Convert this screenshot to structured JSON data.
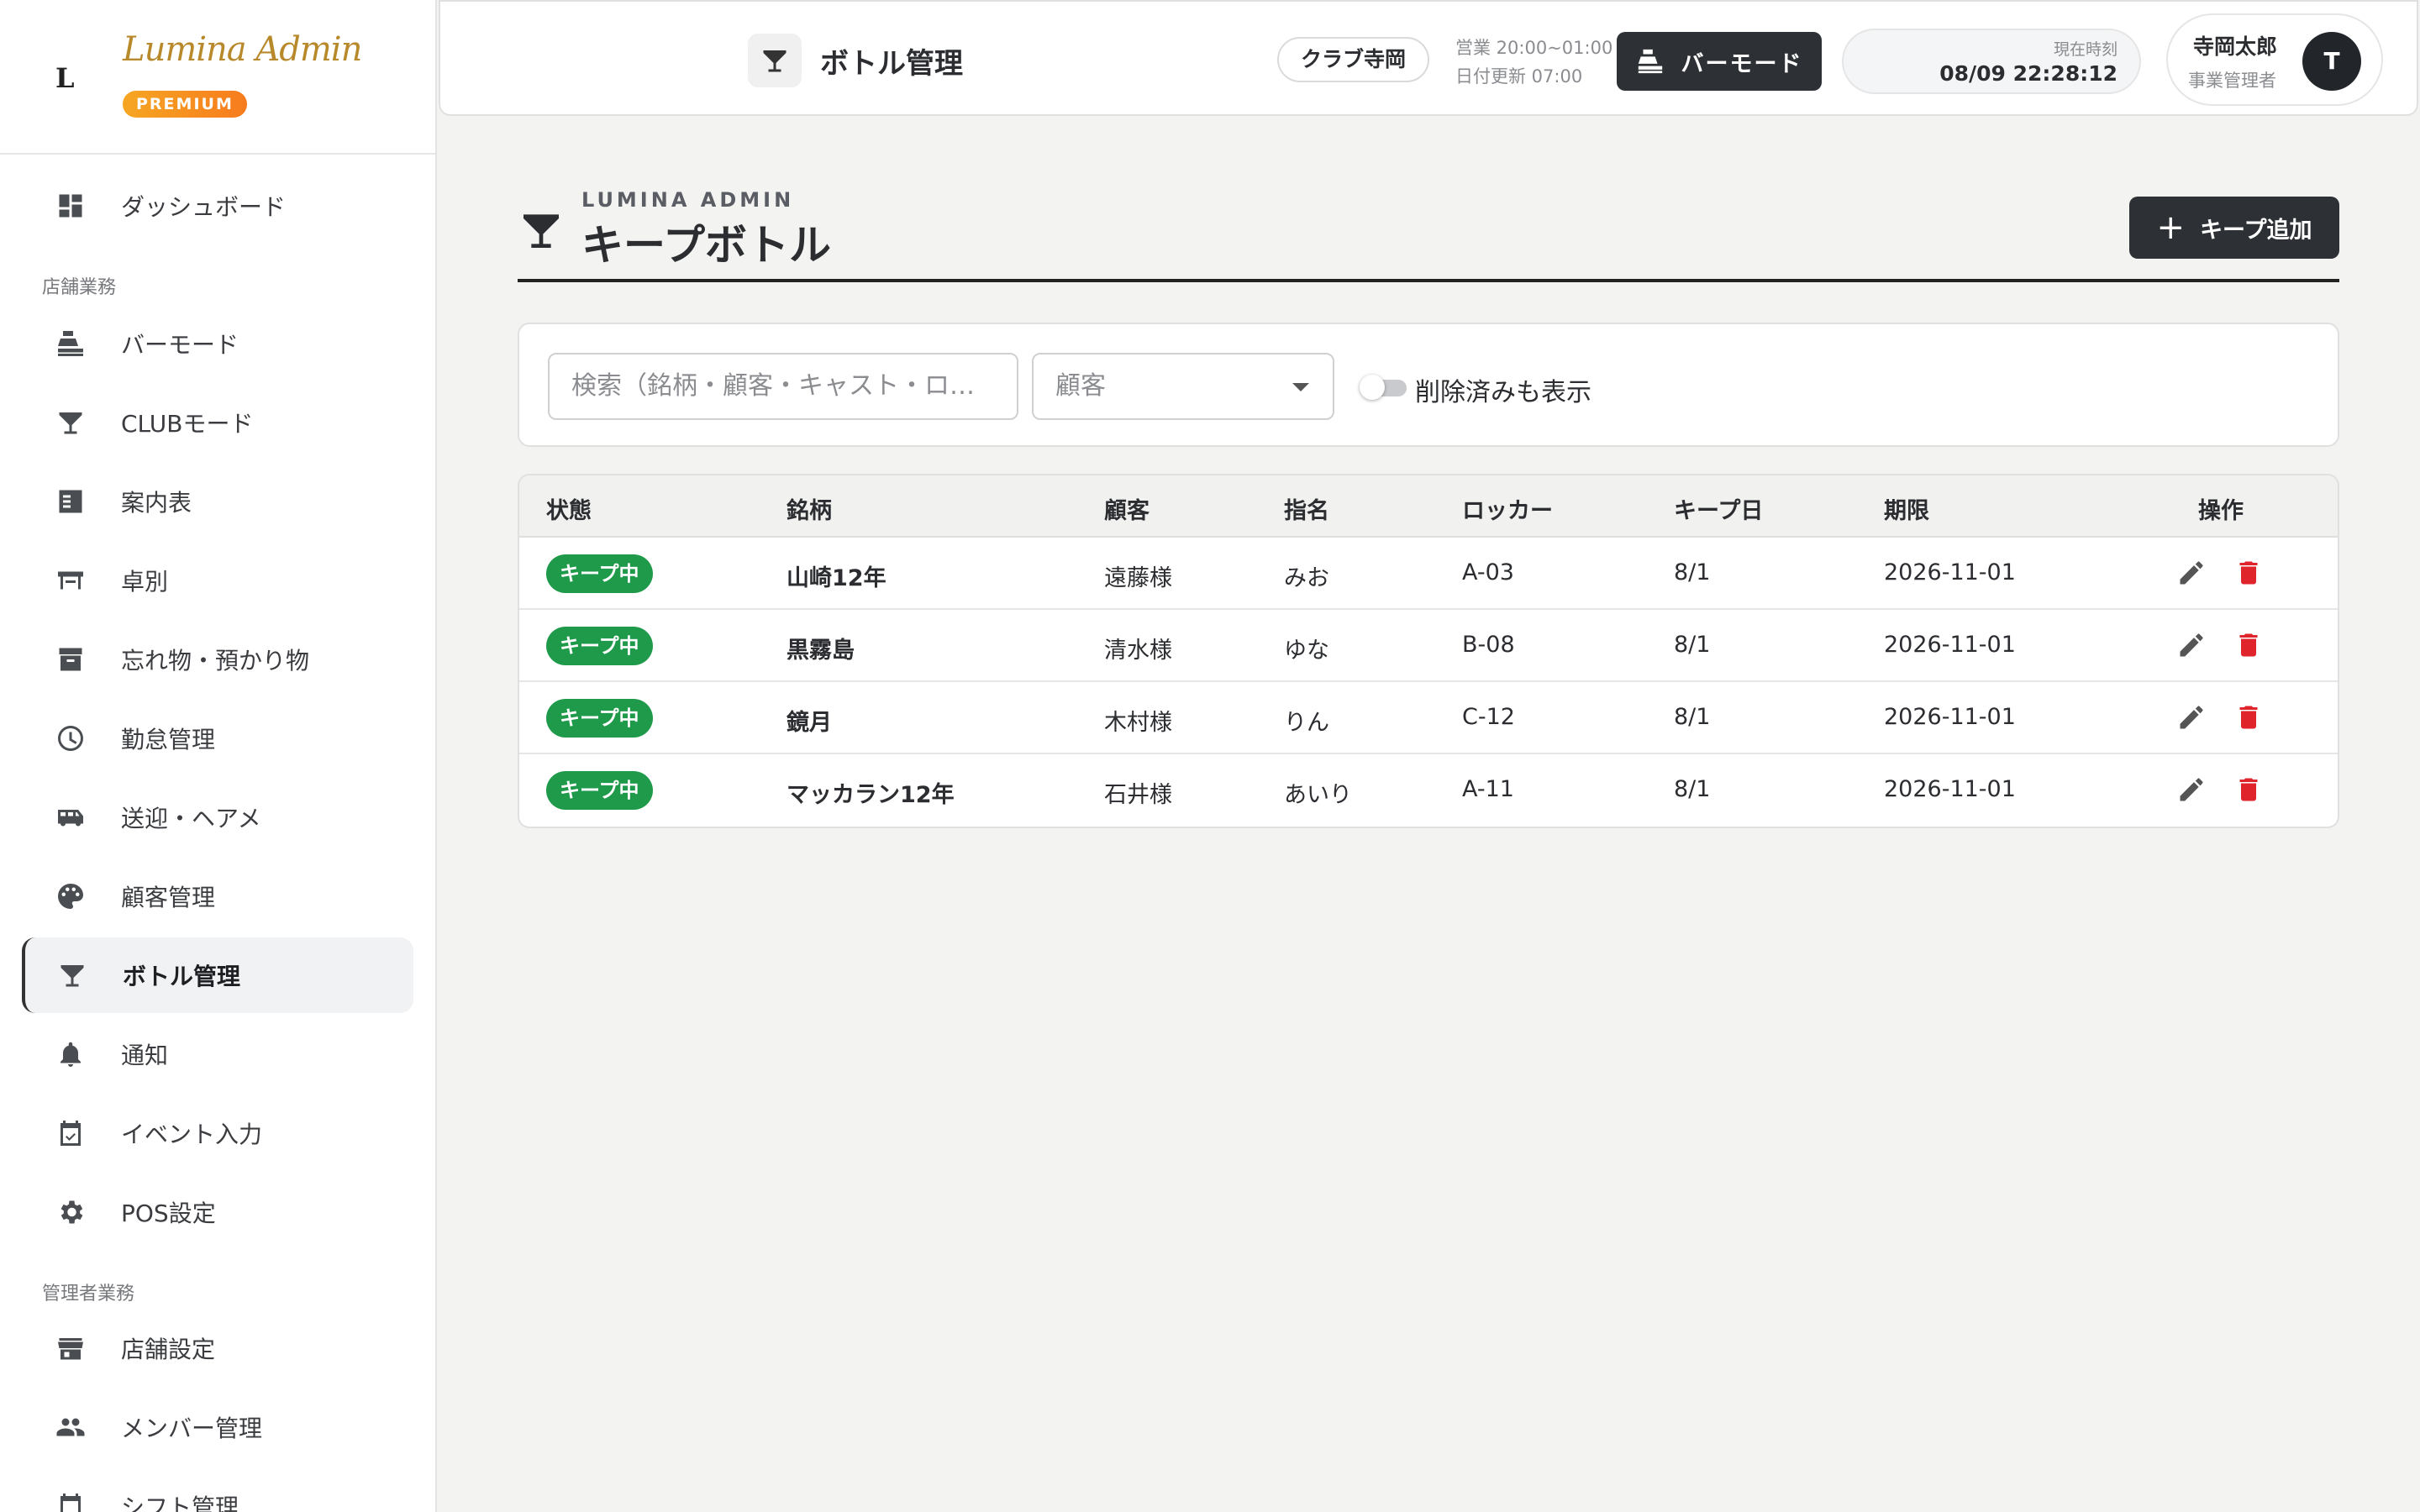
{
  "brand": {
    "mark": "L",
    "name": "Lumina Admin",
    "badge": "PREMIUM"
  },
  "sidebar": {
    "items": [
      {
        "label": "ダッシュボード",
        "icon": "dashboard-icon"
      },
      {
        "label": "バーモード",
        "icon": "cash-register-icon"
      },
      {
        "label": "CLUBモード",
        "icon": "cocktail-glass-icon"
      },
      {
        "label": "案内表",
        "icon": "checklist-icon"
      },
      {
        "label": "卓別",
        "icon": "table-icon"
      },
      {
        "label": "忘れ物・預かり物",
        "icon": "archive-box-icon"
      },
      {
        "label": "勤怠管理",
        "icon": "clock-icon"
      },
      {
        "label": "送迎・ヘアメ",
        "icon": "bus-icon"
      },
      {
        "label": "顧客管理",
        "icon": "palette-icon"
      },
      {
        "label": "ボトル管理",
        "icon": "cocktail-glass-icon",
        "active": true
      },
      {
        "label": "通知",
        "icon": "bell-icon"
      },
      {
        "label": "イベント入力",
        "icon": "calendar-check-icon"
      },
      {
        "label": "POS設定",
        "icon": "gear-icon"
      },
      {
        "label": "店舗設定",
        "icon": "store-icon"
      },
      {
        "label": "メンバー管理",
        "icon": "people-icon"
      },
      {
        "label": "シフト管理",
        "icon": "calendar-icon"
      }
    ],
    "sections": {
      "store": "店舗業務",
      "admin": "管理者業務"
    }
  },
  "header": {
    "title": "ボトル管理",
    "store": "クラブ寺岡",
    "hours": "営業 20:00~01:00",
    "date_change": "日付更新 07:00",
    "barmode_label": "バーモード",
    "clock_label": "現在時刻",
    "clock_time": "08/09 22:28:12",
    "user_name": "寺岡太郎",
    "user_role": "事業管理者",
    "avatar_initial": "T"
  },
  "page": {
    "kicker": "LUMINA ADMIN",
    "title": "キープボトル",
    "add_label": "キープ追加"
  },
  "filters": {
    "search_placeholder": "検索（銘柄・顧客・キャスト・ロ…",
    "customer_placeholder": "顧客",
    "toggle_label": "削除済みも表示"
  },
  "table": {
    "columns": [
      "状態",
      "銘柄",
      "顧客",
      "指名",
      "ロッカー",
      "キープ日",
      "期限",
      "操作"
    ],
    "rows": [
      {
        "status": "キープ中",
        "brand": "山崎12年",
        "customer": "遠藤様",
        "cast": "みお",
        "locker": "A-03",
        "keep_date": "8/1",
        "expiry": "2026-11-01"
      },
      {
        "status": "キープ中",
        "brand": "黒霧島",
        "customer": "清水様",
        "cast": "ゆな",
        "locker": "B-08",
        "keep_date": "8/1",
        "expiry": "2026-11-01"
      },
      {
        "status": "キープ中",
        "brand": "鏡月",
        "customer": "木村様",
        "cast": "りん",
        "locker": "C-12",
        "keep_date": "8/1",
        "expiry": "2026-11-01"
      },
      {
        "status": "キープ中",
        "brand": "マッカラン12年",
        "customer": "石井様",
        "cast": "あいり",
        "locker": "A-11",
        "keep_date": "8/1",
        "expiry": "2026-11-01"
      }
    ]
  },
  "colors": {
    "accent": "#2d3136",
    "status_green": "#1f9a4a",
    "danger": "#e0242b",
    "brand_gold": "#b8892a"
  }
}
